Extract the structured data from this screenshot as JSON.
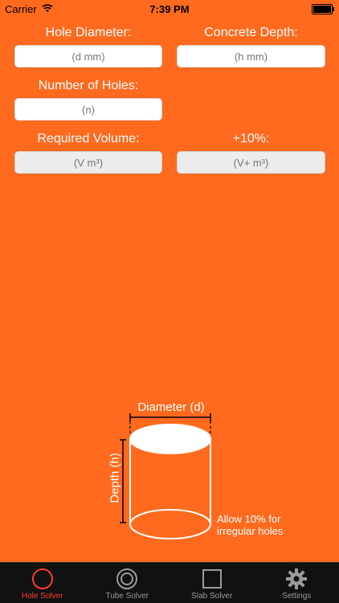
{
  "status": {
    "carrier": "Carrier",
    "time": "7:39 PM"
  },
  "form": {
    "hole_diameter_label": "Hole Diameter:",
    "hole_diameter_placeholder": "(d mm)",
    "concrete_depth_label": "Concrete Depth:",
    "concrete_depth_placeholder": "(h mm)",
    "number_of_holes_label": "Number of Holes:",
    "number_of_holes_placeholder": "(n)",
    "required_volume_label": "Required Volume:",
    "required_volume_placeholder": "(V m³)",
    "plus10_label": "+10%:",
    "plus10_placeholder": "(V+ m³)"
  },
  "diagram": {
    "diameter_label": "Diameter (d)",
    "depth_label": "Depth (h)",
    "note_line1": "Allow 10% for",
    "note_line2": "irregular holes"
  },
  "tabs": [
    {
      "label": "Hole Solver",
      "icon": "circle-icon",
      "active": true
    },
    {
      "label": "Tube Solver",
      "icon": "ring-icon",
      "active": false
    },
    {
      "label": "Slab Solver",
      "icon": "square-icon",
      "active": false
    },
    {
      "label": "Settings",
      "icon": "gear-icon",
      "active": false
    }
  ],
  "colors": {
    "background": "#FF6A1E",
    "active_tab": "#FF3B30",
    "tabbar": "#111111"
  }
}
